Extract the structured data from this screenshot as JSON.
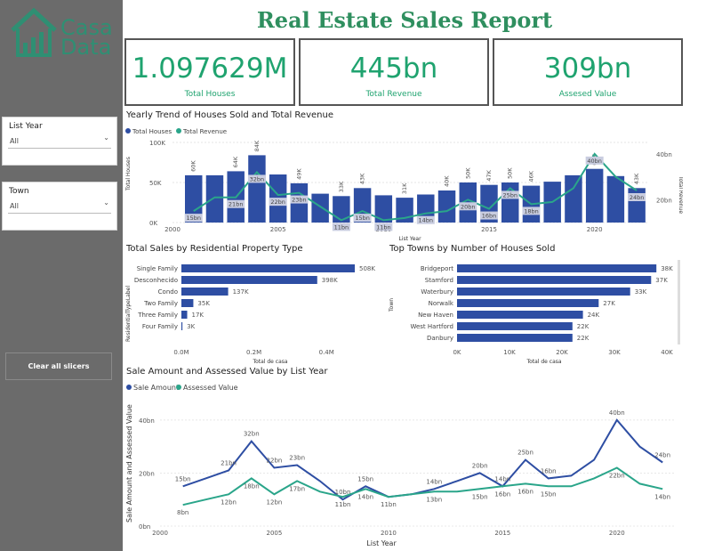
{
  "app": {
    "title": "Real Estate Sales Report",
    "logo_line1": "Casa",
    "logo_line2": "Data"
  },
  "slicers": {
    "list_year": {
      "label": "List Year",
      "value": "All"
    },
    "town": {
      "label": "Town",
      "value": "All"
    },
    "clear_label": "Clear all slicers"
  },
  "kpis": [
    {
      "value": "1.097629M",
      "label": "Total Houses"
    },
    {
      "value": "445bn",
      "label": "Total Revenue"
    },
    {
      "value": "309bn",
      "label": "Assesed Value"
    }
  ],
  "colors": {
    "accent": "#1fa36f",
    "bar": "#2e4ea3",
    "line": "#2aa58a",
    "sidebar": "#6b6b6b"
  },
  "chart_data": [
    {
      "type": "bar",
      "title": "Yearly Trend of Houses Sold and Total Revenue",
      "legend": [
        "Total Houses",
        "Total Revenue"
      ],
      "xlabel": "List Year",
      "ylabel_left": "Total Houses",
      "ylabel_right": "Total Revenue",
      "x_ticks": [
        "2000",
        "2005",
        "2010",
        "2015",
        "2020"
      ],
      "y_ticks_left": [
        "0K",
        "50K",
        "100K"
      ],
      "y_ticks_right": [
        "20bn",
        "40bn"
      ],
      "years": [
        2001,
        2002,
        2003,
        2004,
        2005,
        2006,
        2007,
        2008,
        2009,
        2010,
        2011,
        2012,
        2013,
        2014,
        2015,
        2016,
        2017,
        2018,
        2019,
        2020,
        2021,
        2022
      ],
      "houses": [
        59,
        59,
        64,
        84,
        60,
        49,
        36,
        33,
        43,
        34,
        31,
        35,
        40,
        50,
        47,
        50,
        46,
        51,
        59,
        67,
        58,
        43
      ],
      "house_labels": [
        "60K",
        "",
        "64K",
        "84K",
        "",
        "49K",
        "",
        "33K",
        "43K",
        "",
        "31K",
        "",
        "40K",
        "50K",
        "47K",
        "50K",
        "46K",
        "",
        "",
        "67K",
        "",
        "43K"
      ],
      "revenue": [
        15,
        21,
        21,
        32,
        22,
        23,
        17,
        11,
        15,
        11,
        12,
        14,
        15,
        20,
        16,
        25,
        18,
        19,
        25,
        40,
        30,
        24
      ],
      "revenue_labels": [
        "15bn",
        "",
        "21bn",
        "32bn",
        "22bn",
        "23bn",
        "",
        "11bn",
        "15bn",
        "11bn",
        "",
        "14bn",
        "",
        "20bn",
        "16bn",
        "25bn",
        "18bn",
        "",
        "",
        "40bn",
        "",
        "24bn"
      ],
      "ylim_left": [
        0,
        100
      ],
      "ylim_right": [
        10,
        45
      ]
    },
    {
      "type": "bar",
      "title": "Total Sales by Residential Property Type",
      "xlabel": "Total de casa",
      "ylabel": "ResidentialTypeLabel",
      "categories": [
        "Single Family",
        "Desconhecido",
        "Condo",
        "Two Family",
        "Three Family",
        "Four Family"
      ],
      "values": [
        508,
        398,
        137,
        35,
        17,
        3
      ],
      "labels": [
        "508K",
        "398K",
        "137K",
        "35K",
        "17K",
        "3K"
      ],
      "x_ticks": [
        "0.0M",
        "0.2M",
        "0.4M"
      ],
      "xlim": [
        0,
        0.5
      ]
    },
    {
      "type": "bar",
      "title": "Top Towns by Number of Houses Sold",
      "xlabel": "Total de casa",
      "ylabel": "Town",
      "categories": [
        "Bridgeport",
        "Stamford",
        "Waterbury",
        "Norwalk",
        "New Haven",
        "West Hartford",
        "Danbury"
      ],
      "values": [
        38,
        37,
        33,
        27,
        24,
        22,
        22
      ],
      "labels": [
        "38K",
        "37K",
        "33K",
        "27K",
        "24K",
        "22K",
        "22K"
      ],
      "x_ticks": [
        "0K",
        "10K",
        "20K",
        "30K",
        "40K"
      ],
      "xlim": [
        0,
        40
      ]
    },
    {
      "type": "line",
      "title": "Sale Amount and Assessed Value by List Year",
      "legend": [
        "Sale Amount",
        "Assessed Value"
      ],
      "xlabel": "List Year",
      "ylabel": "Sale Amount and Assessed Value",
      "x_ticks": [
        "2000",
        "2005",
        "2010",
        "2015",
        "2020"
      ],
      "y_ticks": [
        "0bn",
        "20bn",
        "40bn"
      ],
      "years": [
        2001,
        2002,
        2003,
        2004,
        2005,
        2006,
        2007,
        2008,
        2009,
        2010,
        2011,
        2012,
        2013,
        2014,
        2015,
        2016,
        2017,
        2018,
        2019,
        2020,
        2021,
        2022
      ],
      "series": [
        {
          "name": "Sale Amount",
          "values": [
            15,
            18,
            21,
            32,
            22,
            23,
            17,
            10,
            15,
            11,
            12,
            14,
            17,
            20,
            15,
            25,
            18,
            19,
            25,
            40,
            30,
            24
          ],
          "labels": [
            "15bn",
            "",
            "21bn",
            "32bn",
            "22bn",
            "23bn",
            "",
            "10bn",
            "15bn",
            "",
            "",
            "14bn",
            "",
            "20bn",
            "14bn",
            "25bn",
            "16bn",
            "",
            "",
            "40bn",
            "",
            "24bn"
          ]
        },
        {
          "name": "Assessed Value",
          "values": [
            8,
            10,
            12,
            18,
            12,
            17,
            13,
            11,
            14,
            11,
            12,
            13,
            13,
            14,
            15,
            16,
            15,
            15,
            18,
            22,
            16,
            14
          ],
          "labels": [
            "8bn",
            "",
            "12bn",
            "18bn",
            "12bn",
            "17bn",
            "",
            "11bn",
            "14bn",
            "11bn",
            "",
            "13bn",
            "",
            "15bn",
            "16bn",
            "16bn",
            "15bn",
            "",
            "",
            "22bn",
            "",
            "14bn"
          ]
        }
      ],
      "ylim": [
        0,
        45
      ]
    }
  ]
}
